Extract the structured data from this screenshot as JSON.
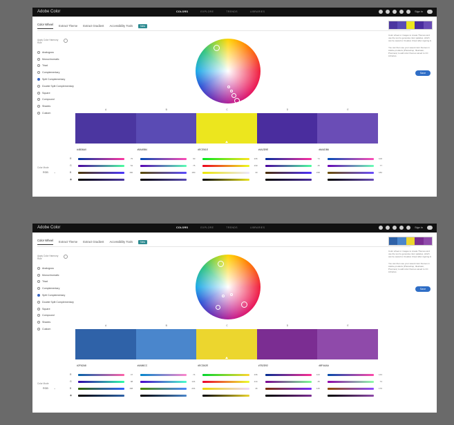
{
  "app": {
    "title": "Adobe Color"
  },
  "nav": [
    "COLORS",
    "EXPLORE",
    "TRENDS",
    "LIBRARIES"
  ],
  "topbar": {
    "signin": "Sign In"
  },
  "tabs": [
    "Color Wheel",
    "Extract Theme",
    "Extract Gradient",
    "Accessibility Tools"
  ],
  "new_badge": "New",
  "rule_label": "Apply Color Harmony Rule",
  "rules": [
    "Analogous",
    "Monochromatic",
    "Triad",
    "Complementary",
    "Split Complementary",
    "Double Split Complementary",
    "Square",
    "Compound",
    "Shades",
    "Custom"
  ],
  "selected_rule": "Split Complementary",
  "color_mode_label": "Color Mode",
  "color_mode": "RGB",
  "channels": [
    "R",
    "G",
    "B"
  ],
  "panels": [
    {
      "swatch_letters": [
        "A",
        "B",
        "C",
        "D",
        "E"
      ],
      "colors": [
        "#4b36a0",
        "#5a4bb4",
        "#ece61e",
        "#4a2d9e",
        "#6a4db6"
      ],
      "hexes": [
        "#4B36A0",
        "#5A4BB4",
        "#ECE61E",
        "#4A2D9E",
        "#6A4DB6"
      ],
      "rgb": [
        [
          75,
          54,
          160
        ],
        [
          90,
          75,
          180
        ],
        [
          236,
          230,
          30
        ],
        [
          74,
          45,
          158
        ],
        [
          106,
          77,
          182
        ]
      ],
      "mini": [
        "#4b36a0",
        "#5a4bb4",
        "#ece61e",
        "#4a2d9e",
        "#6a4db6"
      ],
      "text1": "Color wheel or images to create Themes and use the tool to generate color palettes, which can be saved to Creative Cloud after signing in.",
      "text2": "You can then use your saved color themes in Adobe products (Photoshop, Illustrator, Premiere) to add color themes saved to CC Libraries.",
      "save": "Save"
    },
    {
      "swatch_letters": [
        "A",
        "B",
        "C",
        "D",
        "E"
      ],
      "colors": [
        "#2f62a8",
        "#4a86cc",
        "#ecd62e",
        "#7b2d92",
        "#8f4aaa"
      ],
      "hexes": [
        "#2F62A8",
        "#4A86CC",
        "#ECD62E",
        "#7B2D92",
        "#8F4AAA"
      ],
      "rgb": [
        [
          47,
          98,
          168
        ],
        [
          74,
          134,
          204
        ],
        [
          236,
          214,
          46
        ],
        [
          123,
          45,
          146
        ],
        [
          143,
          74,
          170
        ]
      ],
      "mini": [
        "#2f62a8",
        "#4a86cc",
        "#ecd62e",
        "#7b2d92",
        "#8f4aaa"
      ],
      "text1": "Color wheel or images to create Themes and use the tool to generate color palettes, which can be saved to Creative Cloud after signing in.",
      "text2": "You can then use your saved color themes in Adobe products (Photoshop, Illustrator, Premiere) to add color themes saved to CC Libraries.",
      "save": "Save"
    }
  ]
}
